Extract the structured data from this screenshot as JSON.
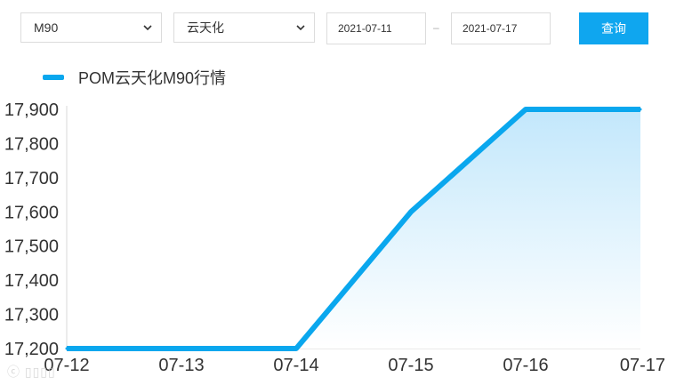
{
  "filters": {
    "grade_select": "M90",
    "company_select": "云天化",
    "start_date": "2021-07-11",
    "date_separator": "–",
    "end_date": "2021-07-17",
    "query_label": "查询"
  },
  "colors": {
    "line": "#0aa7ee",
    "button": "#0fa6ef"
  },
  "chart_data": {
    "type": "area",
    "series": [
      {
        "name": "POM云天化M90行情",
        "x": [
          "07-12",
          "07-13",
          "07-14",
          "07-15",
          "07-16",
          "07-17"
        ],
        "values": [
          17200,
          17200,
          17200,
          17600,
          17900,
          17900
        ]
      }
    ],
    "categories": [
      "07-12",
      "07-13",
      "07-14",
      "07-15",
      "07-16",
      "07-17"
    ],
    "y_ticks": [
      "17,200",
      "17,300",
      "17,400",
      "17,500",
      "17,600",
      "17,700",
      "17,800",
      "17,900"
    ],
    "ylim": [
      17200,
      17900
    ],
    "legend_position": "top-left",
    "grid": false
  }
}
